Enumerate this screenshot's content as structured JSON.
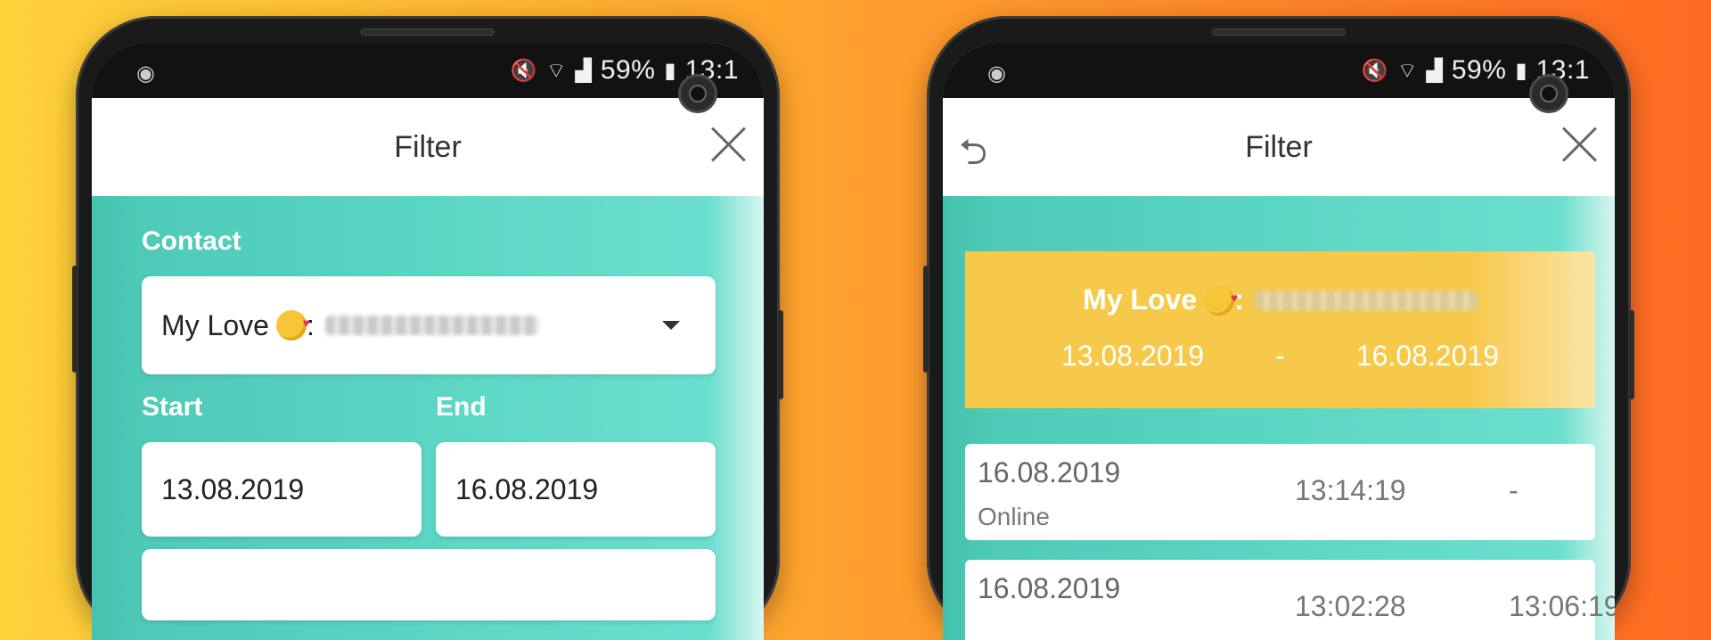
{
  "status_bar": {
    "battery": "59%",
    "time": "13:1"
  },
  "left_screen": {
    "title": "Filter",
    "contact_label": "Contact",
    "contact_value": "My Love",
    "contact_suffix": ":",
    "start_label": "Start",
    "end_label": "End",
    "start_value": "13.08.2019",
    "end_value": "16.08.2019"
  },
  "right_screen": {
    "title": "Filter",
    "summary": {
      "contact": "My Love",
      "suffix": ":",
      "start": "13.08.2019",
      "separator": "-",
      "end": "16.08.2019"
    },
    "rows": [
      {
        "date": "16.08.2019",
        "status": "Online",
        "time_from": "13:14:19",
        "time_to": "-"
      },
      {
        "date": "16.08.2019",
        "status": "",
        "time_from": "13:02:28",
        "time_to": "13:06:19"
      }
    ]
  },
  "colors": {
    "teal": "#55cfbd",
    "yellow": "#f7c94a",
    "background_orange": "#ff8a2a"
  }
}
